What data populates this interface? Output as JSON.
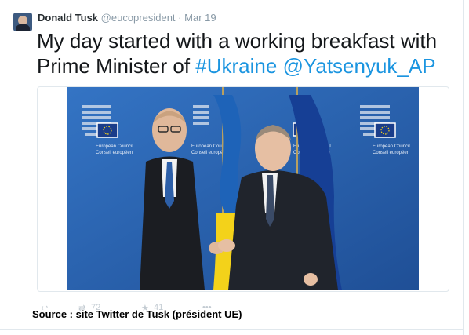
{
  "tweet": {
    "author_name": "Donald Tusk",
    "author_handle": "@eucopresident",
    "separator": "·",
    "date": "Mar 19",
    "text_parts": {
      "text": "My day started with a working breakfast with Prime Minister of ",
      "hashtag": "#Ukraine",
      "space": " ",
      "mention": "@Yatsenyuk_AP"
    }
  },
  "photo": {
    "backdrop_label_line1": "European Council",
    "backdrop_label_line2": "Conseil européen"
  },
  "actions": {
    "retweets": "72",
    "likes": "41"
  },
  "caption": "Source : site Twitter de Tusk (président UE)",
  "colors": {
    "link": "#1b95e0",
    "backdrop": "#2f68b5",
    "flag_ukraine_blue": "#1e63b8",
    "flag_ukraine_yellow": "#f3d21a"
  }
}
